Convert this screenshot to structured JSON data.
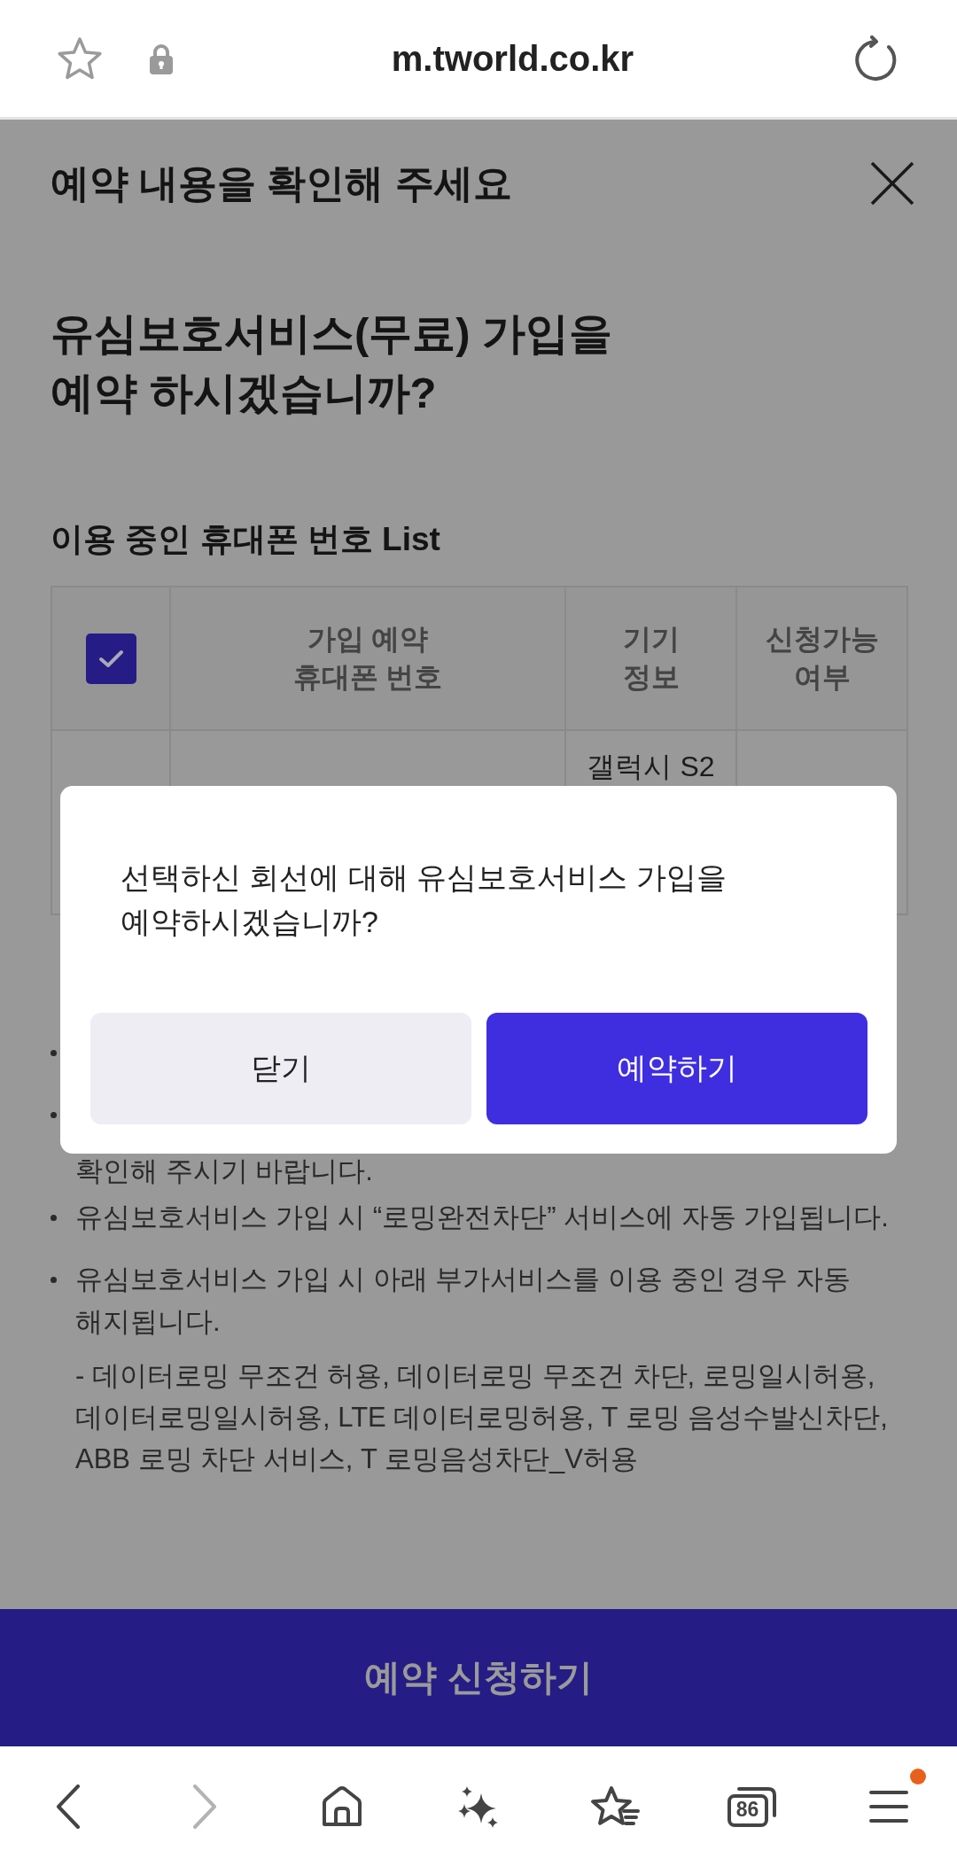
{
  "browser_bar": {
    "url": "m.tworld.co.kr"
  },
  "page": {
    "title": "예약 내용을 확인해 주세요",
    "question": "유심보호서비스(무료) 가입을\n예약 하시겠습니까?",
    "list_title": "이용 중인 휴대폰 번호 List"
  },
  "table": {
    "select_all": {
      "checked": true
    },
    "columns": [
      "가입 예약\n휴대폰 번호",
      "기기\n정보",
      "신청가능\n여부"
    ],
    "rows": [
      {
        "device": "갤럭시 S2"
      }
    ]
  },
  "notices": [
    {
      "kind": "covered"
    },
    {
      "kind": "covered",
      "tail": "확인해 주시기 바랍니다."
    },
    {
      "kind": "text",
      "text": "유심보호서비스 가입 시 “로밍완전차단” 서비스에 자동 가입됩니다."
    },
    {
      "kind": "text",
      "text": "유심보호서비스 가입 시 아래 부가서비스를 이용 중인 경우 자동 해지됩니다.",
      "note": "- 데이터로밍 무조건 허용, 데이터로밍 무조건 차단, 로밍일시허용, 데이터로밍일시허용, LTE 데이터로밍허용, T 로밍 음성수발신차단, ABB 로밍 차단 서비스, T 로밍음성차단_V허용"
    }
  ],
  "submit_button": {
    "label": "예약 신청하기"
  },
  "dialog": {
    "message": "선택하신 회선에 대해 유심보호서비스 가입을 예약하시겠습니까?",
    "buttons": [
      {
        "kind": "secondary",
        "label": "닫기"
      },
      {
        "kind": "primary",
        "label": "예약하기"
      }
    ]
  },
  "bottom_nav": {
    "items": [
      {
        "kind": "back",
        "disabled": false,
        "badge": false
      },
      {
        "kind": "forward",
        "disabled": true,
        "badge": false
      },
      {
        "kind": "home",
        "disabled": false,
        "badge": false
      },
      {
        "kind": "sparkle",
        "disabled": false,
        "badge": false
      },
      {
        "kind": "bookmarks",
        "disabled": false,
        "badge": false
      },
      {
        "kind": "tabs",
        "count": "86",
        "disabled": false,
        "badge": false
      },
      {
        "kind": "menu",
        "disabled": false,
        "badge": true
      }
    ]
  }
}
